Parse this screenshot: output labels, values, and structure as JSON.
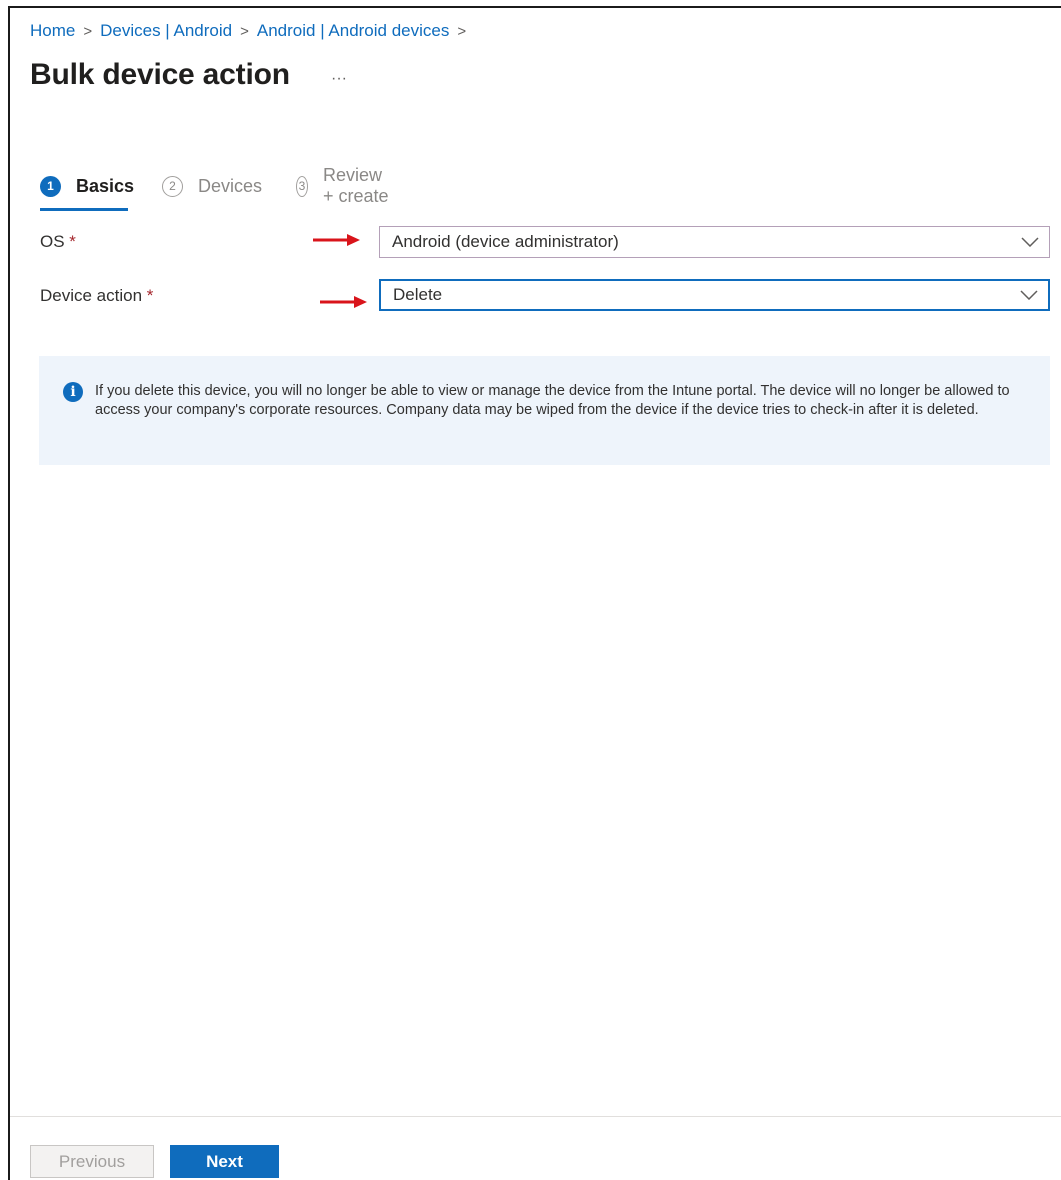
{
  "breadcrumb": {
    "items": [
      "Home",
      "Devices | Android",
      "Android | Android devices"
    ],
    "separator": ">"
  },
  "page": {
    "title": "Bulk device action",
    "more_label": "···"
  },
  "wizard": {
    "tabs": [
      {
        "number": "1",
        "label": "Basics",
        "state": "active"
      },
      {
        "number": "2",
        "label": "Devices",
        "state": "inactive"
      },
      {
        "number": "3",
        "label": "Review + create",
        "state": "inactive"
      }
    ]
  },
  "form": {
    "os": {
      "label": "OS",
      "required_mark": "*",
      "value": "Android (device administrator)"
    },
    "device_action": {
      "label": "Device action",
      "required_mark": "*",
      "value": "Delete"
    }
  },
  "info": {
    "icon": "info-icon",
    "text": "If you delete this device, you will no longer be able to view or manage the device from the Intune portal. The device will no longer be allowed to access your company's corporate resources. Company data may be wiped from the device if the device tries to check-in after it is deleted."
  },
  "footer": {
    "previous_label": "Previous",
    "next_label": "Next"
  },
  "colors": {
    "accent": "#0f6cbd",
    "annotation_arrow": "#d9141b",
    "info_background": "#eef4fb",
    "required": "#a4262c"
  }
}
